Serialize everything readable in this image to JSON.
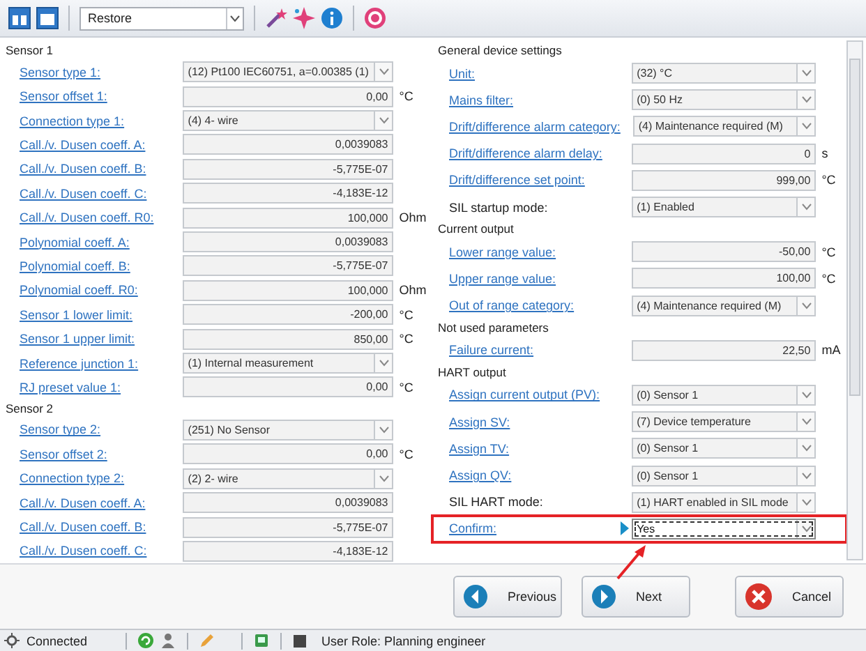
{
  "toolbar": {
    "view_value": "Restore"
  },
  "left_sections": [
    {
      "title": "Sensor 1",
      "rows": [
        {
          "label": "Sensor type 1:",
          "link": true,
          "kind": "select",
          "value": "(12) Pt100 IEC60751, a=0.00385 (1)",
          "active": false
        },
        {
          "label": "Sensor offset 1:",
          "link": true,
          "kind": "number",
          "value": "0,00",
          "unit": "°C",
          "active": false
        },
        {
          "label": "Connection type 1:",
          "link": true,
          "kind": "select",
          "value": "(4) 4- wire",
          "active": false
        },
        {
          "label": "Call./v. Dusen coeff. A:",
          "link": true,
          "kind": "number",
          "value": "0,0039083",
          "active": false
        },
        {
          "label": "Call./v. Dusen coeff. B:",
          "link": true,
          "kind": "number",
          "value": "-5,775E-07",
          "active": false
        },
        {
          "label": "Call./v. Dusen coeff. C:",
          "link": true,
          "kind": "number",
          "value": "-4,183E-12",
          "active": false
        },
        {
          "label": "Call./v. Dusen coeff. R0:",
          "link": true,
          "kind": "number",
          "value": "100,000",
          "unit": "Ohm",
          "active": false
        },
        {
          "label": "Polynomial coeff. A:",
          "link": true,
          "kind": "number",
          "value": "0,0039083",
          "active": false
        },
        {
          "label": "Polynomial coeff. B:",
          "link": true,
          "kind": "number",
          "value": "-5,775E-07",
          "active": false
        },
        {
          "label": "Polynomial coeff. R0:",
          "link": true,
          "kind": "number",
          "value": "100,000",
          "unit": "Ohm",
          "active": false
        },
        {
          "label": "Sensor 1 lower limit:",
          "link": true,
          "kind": "number",
          "value": "-200,00",
          "unit": "°C",
          "active": false
        },
        {
          "label": "Sensor 1 upper limit:",
          "link": true,
          "kind": "number",
          "value": "850,00",
          "unit": "°C",
          "active": false
        },
        {
          "label": "Reference junction 1:",
          "link": true,
          "kind": "select",
          "value": "(1) Internal measurement",
          "active": false
        },
        {
          "label": "RJ preset value 1:",
          "link": true,
          "kind": "number",
          "value": "0,00",
          "unit": "°C",
          "active": false
        }
      ]
    },
    {
      "title": "Sensor 2",
      "rows": [
        {
          "label": "Sensor type 2:",
          "link": true,
          "kind": "select",
          "value": "(251) No Sensor",
          "active": false
        },
        {
          "label": "Sensor offset 2:",
          "link": true,
          "kind": "number",
          "value": "0,00",
          "unit": "°C",
          "active": false
        },
        {
          "label": "Connection type 2:",
          "link": true,
          "kind": "select",
          "value": "(2) 2- wire",
          "active": false
        },
        {
          "label": "Call./v. Dusen coeff. A:",
          "link": true,
          "kind": "number",
          "value": "0,0039083",
          "active": false
        },
        {
          "label": "Call./v. Dusen coeff. B:",
          "link": true,
          "kind": "number",
          "value": "-5,775E-07",
          "active": false
        },
        {
          "label": "Call./v. Dusen coeff. C:",
          "link": true,
          "kind": "number",
          "value": "-4,183E-12",
          "active": false
        }
      ]
    }
  ],
  "right_sections": [
    {
      "title": "General device settings",
      "rows": [
        {
          "label": "Unit:",
          "link": true,
          "kind": "select",
          "value": "(32) °C",
          "active": false
        },
        {
          "label": "Mains filter:",
          "link": true,
          "kind": "select",
          "value": "(0) 50 Hz",
          "active": false
        },
        {
          "label": "Drift/difference alarm category:",
          "link": true,
          "kind": "select",
          "value": "(4) Maintenance required (M)",
          "active": false
        },
        {
          "label": "Drift/difference alarm delay:",
          "link": true,
          "kind": "number",
          "value": "0",
          "unit": "s",
          "active": false
        },
        {
          "label": "Drift/difference set point:",
          "link": true,
          "kind": "number",
          "value": "999,00",
          "unit": "°C",
          "active": false
        },
        {
          "label": "SIL startup mode:",
          "link": false,
          "kind": "select",
          "value": "(1) Enabled",
          "active": false
        }
      ]
    },
    {
      "title": "Current output",
      "rows": [
        {
          "label": "Lower range value:",
          "link": true,
          "kind": "number",
          "value": "-50,00",
          "unit": "°C",
          "active": false
        },
        {
          "label": "Upper range value:",
          "link": true,
          "kind": "number",
          "value": "100,00",
          "unit": "°C",
          "active": false
        },
        {
          "label": "Out of range category:",
          "link": true,
          "kind": "select",
          "value": "(4) Maintenance required (M)",
          "active": false
        }
      ]
    },
    {
      "title": "Not used parameters",
      "rows": [
        {
          "label": "Failure current:",
          "link": true,
          "kind": "number",
          "value": "22,50",
          "unit": "mA",
          "active": false
        }
      ]
    },
    {
      "title": "HART output",
      "rows": [
        {
          "label": "Assign current output (PV):",
          "link": true,
          "kind": "select",
          "value": "(0) Sensor 1",
          "active": false
        },
        {
          "label": "Assign SV:",
          "link": true,
          "kind": "select",
          "value": "(7) Device temperature",
          "active": false
        },
        {
          "label": "Assign TV:",
          "link": true,
          "kind": "select",
          "value": "(0) Sensor 1",
          "active": false
        },
        {
          "label": "Assign QV:",
          "link": true,
          "kind": "select",
          "value": "(0) Sensor 1",
          "active": false
        },
        {
          "label": "SIL HART mode:",
          "link": false,
          "kind": "select",
          "value": "(1) HART enabled in SIL mode",
          "active": false
        },
        {
          "label": "Confirm:",
          "link": true,
          "kind": "select",
          "value": "Yes",
          "active": true
        }
      ]
    }
  ],
  "buttons": [
    {
      "label": "Previous",
      "kind": "back"
    },
    {
      "label": "Next",
      "kind": "next"
    },
    {
      "label": "Cancel",
      "kind": "cancel"
    }
  ],
  "status_bar": {
    "connection": "Connected",
    "user_role": "User Role: Planning engineer"
  }
}
